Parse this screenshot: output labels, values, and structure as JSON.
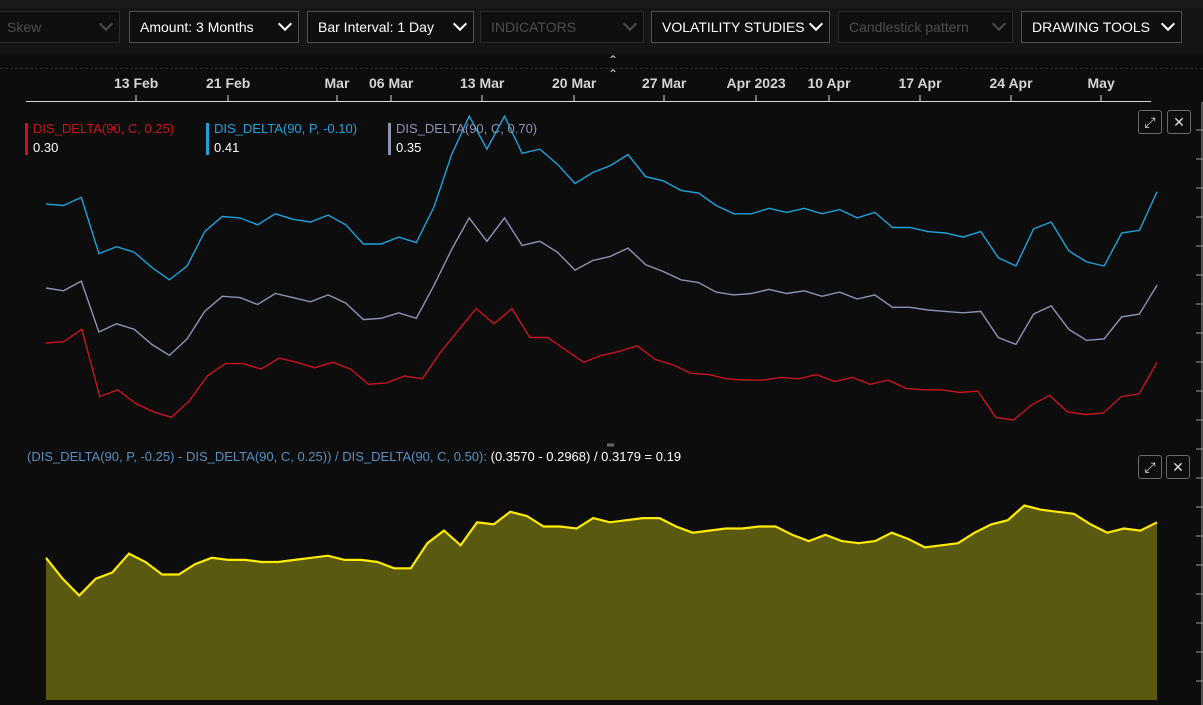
{
  "toolbar": {
    "dropdowns": [
      {
        "label": "Skew",
        "enabled": false
      },
      {
        "label": "Amount: 3 Months",
        "enabled": true
      },
      {
        "label": "Bar Interval: 1 Day",
        "enabled": true
      },
      {
        "label": "INDICATORS",
        "enabled": false
      },
      {
        "label": "VOLATILITY STUDIES",
        "enabled": true
      },
      {
        "label": "Candlestick pattern",
        "enabled": false
      },
      {
        "label": "DRAWING TOOLS",
        "enabled": true
      }
    ],
    "collapse_icon": "double-chevron-up-icon"
  },
  "chart_data": [
    {
      "type": "line",
      "x_tick_labels": [
        "13 Feb",
        "21 Feb",
        "Mar",
        "06 Mar",
        "13 Mar",
        "20 Mar",
        "27 Mar",
        "Apr 2023",
        "10 Apr",
        "17 Apr",
        "24 Apr",
        "May"
      ],
      "series": [
        {
          "name": "DIS_DELTA(90, C, 0.25)",
          "last_value": "0.30",
          "color": "#c8141e",
          "values": [
            0.272,
            0.273,
            0.282,
            0.233,
            0.238,
            0.228,
            0.222,
            0.218,
            0.23,
            0.248,
            0.257,
            0.257,
            0.253,
            0.261,
            0.258,
            0.254,
            0.258,
            0.253,
            0.242,
            0.243,
            0.248,
            0.246,
            0.265,
            0.281,
            0.297,
            0.286,
            0.297,
            0.276,
            0.276,
            0.267,
            0.258,
            0.263,
            0.266,
            0.27,
            0.26,
            0.256,
            0.25,
            0.249,
            0.246,
            0.245,
            0.245,
            0.247,
            0.246,
            0.249,
            0.244,
            0.247,
            0.242,
            0.245,
            0.239,
            0.238,
            0.238,
            0.236,
            0.237,
            0.218,
            0.216,
            0.227,
            0.234,
            0.222,
            0.22,
            0.221,
            0.233,
            0.235,
            0.258
          ]
        },
        {
          "name": "DIS_DELTA(90, P, -0.10)",
          "last_value": "0.41",
          "color": "#1ca3dc",
          "values": [
            0.373,
            0.372,
            0.378,
            0.337,
            0.342,
            0.338,
            0.327,
            0.318,
            0.328,
            0.353,
            0.364,
            0.363,
            0.358,
            0.366,
            0.362,
            0.36,
            0.365,
            0.358,
            0.344,
            0.344,
            0.349,
            0.345,
            0.371,
            0.409,
            0.437,
            0.413,
            0.437,
            0.41,
            0.413,
            0.402,
            0.388,
            0.396,
            0.401,
            0.409,
            0.393,
            0.39,
            0.383,
            0.381,
            0.372,
            0.366,
            0.366,
            0.37,
            0.367,
            0.37,
            0.366,
            0.369,
            0.363,
            0.367,
            0.356,
            0.356,
            0.353,
            0.352,
            0.349,
            0.353,
            0.334,
            0.328,
            0.355,
            0.36,
            0.339,
            0.331,
            0.328,
            0.352,
            0.354,
            0.382
          ]
        },
        {
          "name": "DIS_DELTA(90, C, 0.70)",
          "last_value": "0.35",
          "color": "#8e92b4",
          "values": [
            0.312,
            0.31,
            0.317,
            0.28,
            0.286,
            0.282,
            0.271,
            0.263,
            0.275,
            0.295,
            0.306,
            0.305,
            0.3,
            0.308,
            0.305,
            0.302,
            0.307,
            0.301,
            0.289,
            0.29,
            0.294,
            0.29,
            0.314,
            0.34,
            0.363,
            0.346,
            0.363,
            0.343,
            0.346,
            0.338,
            0.325,
            0.332,
            0.335,
            0.341,
            0.329,
            0.324,
            0.318,
            0.316,
            0.309,
            0.307,
            0.308,
            0.311,
            0.308,
            0.31,
            0.306,
            0.309,
            0.304,
            0.307,
            0.298,
            0.298,
            0.296,
            0.295,
            0.294,
            0.295,
            0.276,
            0.271,
            0.293,
            0.299,
            0.282,
            0.274,
            0.275,
            0.291,
            0.293,
            0.314
          ]
        },
        {
          "name": "DIS_DELTA(90, C, 0.50)",
          "last_value": "0.3179",
          "color": "#7a7a7a",
          "values": []
        }
      ],
      "ylim": [
        0.2,
        0.44
      ],
      "grid": false
    },
    {
      "type": "area",
      "formula_text": "(DIS_DELTA(90, P, -0.25) - DIS_DELTA(90, C, 0.25)) / DIS_DELTA(90, C, 0.50):",
      "result_text": "(0.3570 - 0.2968) / 0.3179 = 0.19",
      "series": [
        {
          "color": "#ffeb00",
          "fill": "#595a10",
          "values": [
            0.168,
            0.158,
            0.15,
            0.158,
            0.161,
            0.17,
            0.166,
            0.16,
            0.16,
            0.165,
            0.168,
            0.167,
            0.167,
            0.166,
            0.166,
            0.167,
            0.168,
            0.169,
            0.167,
            0.167,
            0.166,
            0.163,
            0.163,
            0.175,
            0.181,
            0.174,
            0.185,
            0.184,
            0.19,
            0.188,
            0.183,
            0.183,
            0.182,
            0.187,
            0.185,
            0.186,
            0.187,
            0.187,
            0.183,
            0.18,
            0.181,
            0.182,
            0.182,
            0.183,
            0.183,
            0.179,
            0.176,
            0.179,
            0.176,
            0.175,
            0.176,
            0.18,
            0.177,
            0.173,
            0.174,
            0.175,
            0.18,
            0.184,
            0.186,
            0.193,
            0.191,
            0.19,
            0.189,
            0.184,
            0.18,
            0.182,
            0.181,
            0.185
          ]
        }
      ],
      "ylim": [
        0.1,
        0.21
      ],
      "grid": false
    }
  ],
  "panels": {
    "expand_icon": "expand-icon",
    "close_icon": "close-icon"
  }
}
